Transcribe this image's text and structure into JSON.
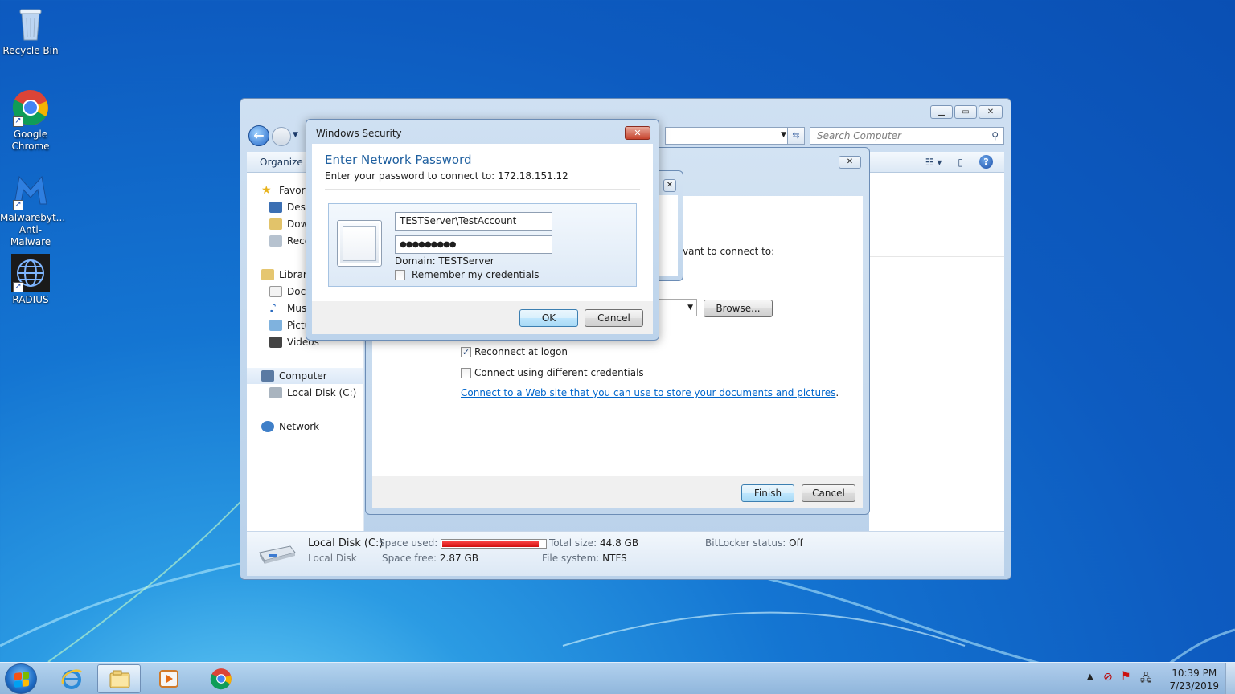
{
  "desktop": {
    "icons": [
      {
        "label": "Recycle Bin"
      },
      {
        "label": "Google Chrome"
      },
      {
        "label": "Malwarebyt... Anti-Malware"
      },
      {
        "label": "RADIUS"
      }
    ]
  },
  "explorer": {
    "search_placeholder": "Search Computer",
    "organize_label": "Organize",
    "sidebar": {
      "favorites": "Favorites",
      "desktop": "Desktop",
      "downloads": "Downloads",
      "recent": "Recent Places",
      "libraries": "Libraries",
      "documents": "Documents",
      "music": "Music",
      "pictures": "Pictures",
      "videos": "Videos",
      "computer": "Computer",
      "local_disk": "Local Disk (C:)",
      "network": "Network"
    },
    "details": {
      "name": "Local Disk (C:)",
      "type": "Local Disk",
      "space_used_label": "Space used:",
      "space_used_fraction": 0.94,
      "space_free_label": "Space free:",
      "space_free_value": "2.87 GB",
      "total_size_label": "Total size:",
      "total_size_value": "44.8 GB",
      "file_system_label": "File system:",
      "file_system_value": "NTFS",
      "bitlocker_label": "BitLocker status:",
      "bitlocker_value": "Off"
    }
  },
  "wizard": {
    "partial_text": "vant to connect to:",
    "browse_label": "Browse...",
    "reconnect_label": "Reconnect at logon",
    "reconnect_checked": true,
    "diff_creds_label": "Connect using different credentials",
    "diff_creds_checked": false,
    "link_text": "Connect to a Web site that you can use to store your documents and pictures",
    "link_suffix": ".",
    "finish_label": "Finish",
    "cancel_label": "Cancel"
  },
  "security_dialog": {
    "title": "Windows Security",
    "heading": "Enter Network Password",
    "subtitle": "Enter your password to connect to: 172.18.151.12",
    "username_value": "TESTServer\\TestAccount",
    "password_mask": "●●●●●●●●●",
    "domain_text": "Domain: TESTServer",
    "remember_label": "Remember my credentials",
    "remember_checked": false,
    "ok_label": "OK",
    "cancel_label": "Cancel"
  },
  "taskbar": {
    "time": "10:39 PM",
    "date": "7/23/2019"
  },
  "colors": {
    "accent_heading": "#1e5f9f",
    "link": "#0066cc",
    "disk_bar": "#d10e0e"
  }
}
